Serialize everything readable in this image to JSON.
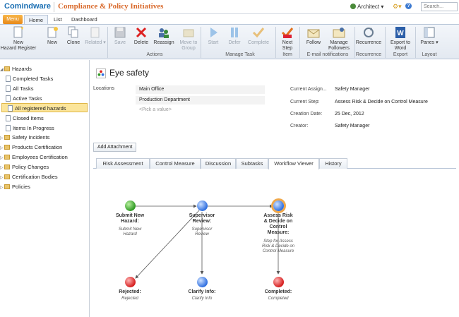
{
  "header": {
    "logo": "Comindware",
    "app_title": "Compliance & Policy Initiatives",
    "user": "Architect",
    "search_placeholder": "Search..."
  },
  "ribbon_tabs": {
    "menu": "Menu",
    "tabs": [
      "Home",
      "List",
      "Dashboard"
    ]
  },
  "ribbon": {
    "buttons": [
      {
        "label": "New\nHazard Register"
      },
      {
        "label": "New"
      },
      {
        "label": "Clone"
      },
      {
        "label": "Related"
      },
      {
        "label": "Save"
      },
      {
        "label": "Delete"
      },
      {
        "label": "Reassign"
      },
      {
        "label": "Move to\nGroup"
      },
      {
        "label": "Start"
      },
      {
        "label": "Defer"
      },
      {
        "label": "Complete"
      },
      {
        "label": "Next\nStep"
      },
      {
        "label": "Follow"
      },
      {
        "label": "Manage\nFollowers"
      },
      {
        "label": "Recurrence"
      },
      {
        "label": "Export to\nWord"
      },
      {
        "label": "Panes"
      }
    ],
    "groups": [
      "Actions",
      "Manage Task",
      "Item",
      "E-mail notifications",
      "Recurrence",
      "Export",
      "Layout"
    ]
  },
  "sidebar": {
    "items": [
      "Hazards",
      "Completed Tasks",
      "All Tasks",
      "Active Tasks",
      "All registered hazards",
      "Closed Items",
      "Items In Progress",
      "Safety Incidents",
      "Products Certification",
      "Employees Certification",
      "Policy Changes",
      "Certification Bodies",
      "Policies"
    ]
  },
  "record": {
    "title": "Eye safety",
    "locations_label": "Locations",
    "locations": [
      "Main Office",
      "Production Department"
    ],
    "pick_value": "<Pick a value>",
    "fields": [
      {
        "label": "Current Assign...",
        "value": "Safety Manager"
      },
      {
        "label": "Current Step:",
        "value": "Assess Risk & Decide on Control Measure"
      },
      {
        "label": "Creation Date:",
        "value": "25 Dec, 2012"
      },
      {
        "label": "Creator:",
        "value": "Safety Manager"
      }
    ],
    "add_attachment": "Add Attachment"
  },
  "detail_tabs": [
    "Risk Assessment",
    "Control Measure",
    "Discussion",
    "Subtasks",
    "Workflow Viewer",
    "History"
  ],
  "workflow": {
    "nodes": [
      {
        "title": "Submit New\nHazard:",
        "sub": "Submit New\nHazard",
        "color": "green"
      },
      {
        "title": "Supervisor\nReview:",
        "sub": "Supervisor\nReview",
        "color": "blue"
      },
      {
        "title": "Assess Risk\n& Decide on\nControl\nMeasure:",
        "sub": "Step for Assess\nRisk & Decide on\nControl Measure",
        "color": "blue"
      },
      {
        "title": "Rejected:",
        "sub": "Rejected",
        "color": "red"
      },
      {
        "title": "Clarify Info:",
        "sub": "Clarify Info",
        "color": "blue"
      },
      {
        "title": "Completed:",
        "sub": "Completed",
        "color": "red"
      }
    ]
  }
}
